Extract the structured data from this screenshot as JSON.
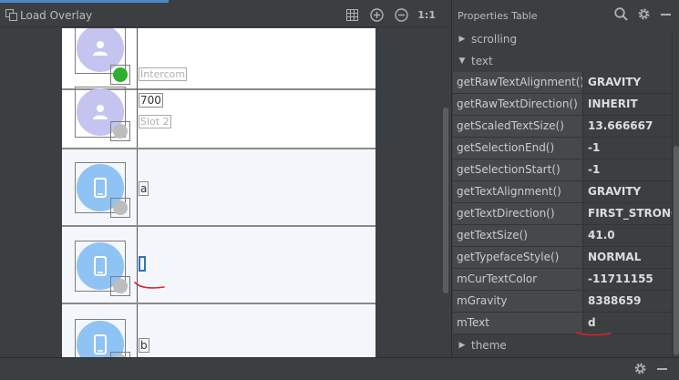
{
  "toolbar": {
    "load_overlay_label": "Load Overlay",
    "zoom_actual_label": "1:1",
    "icons": [
      "load-overlay-icon",
      "grid-icon",
      "zoom-in-icon",
      "zoom-out-icon"
    ]
  },
  "canvas": {
    "rows": [
      {
        "avatar_color": "#c5c3ef",
        "avatar_icon": "person-icon",
        "badge": "green",
        "title": "",
        "subtitle": "Intercom"
      },
      {
        "avatar_color": "#c5c3ef",
        "avatar_icon": "person-icon",
        "badge": "gray",
        "title": "700",
        "subtitle": "Slot 2"
      },
      {
        "avatar_color": "#8fc3f4",
        "avatar_icon": "phone-icon",
        "badge": "gray",
        "title": "a",
        "subtitle": ""
      },
      {
        "avatar_color": "#8fc3f4",
        "avatar_icon": "phone-icon",
        "badge": "gray",
        "title": "",
        "subtitle": "",
        "selected": true
      },
      {
        "avatar_color": "#8fc3f4",
        "avatar_icon": "phone-icon",
        "badge": "gray",
        "title": "b",
        "subtitle": ""
      }
    ]
  },
  "properties": {
    "title": "Properties Table",
    "icons": [
      "search-icon",
      "gear-icon",
      "minimize-icon"
    ],
    "groups": {
      "scrolling": {
        "label": "scrolling",
        "expanded": false
      },
      "text": {
        "label": "text",
        "expanded": true
      },
      "theme": {
        "label": "theme",
        "expanded": false
      }
    },
    "rows": [
      {
        "name": "getRawTextAlignment()",
        "value": "GRAVITY"
      },
      {
        "name": "getRawTextDirection()",
        "value": "INHERIT"
      },
      {
        "name": "getScaledTextSize()",
        "value": "13.666667"
      },
      {
        "name": "getSelectionEnd()",
        "value": "-1"
      },
      {
        "name": "getSelectionStart()",
        "value": "-1"
      },
      {
        "name": "getTextAlignment()",
        "value": "GRAVITY"
      },
      {
        "name": "getTextDirection()",
        "value": "FIRST_STRONG"
      },
      {
        "name": "getTextSize()",
        "value": "41.0"
      },
      {
        "name": "getTypefaceStyle()",
        "value": "NORMAL"
      },
      {
        "name": "mCurTextColor",
        "value": "-11711155"
      },
      {
        "name": "mGravity",
        "value": "8388659"
      },
      {
        "name": "mText",
        "value": "d"
      }
    ]
  },
  "bottom": {
    "icons": [
      "gear-icon",
      "minimize-icon"
    ]
  },
  "colors": {
    "accent": "#4a88c7",
    "annotation": "#e0202a",
    "selection": "#2f73b9"
  }
}
